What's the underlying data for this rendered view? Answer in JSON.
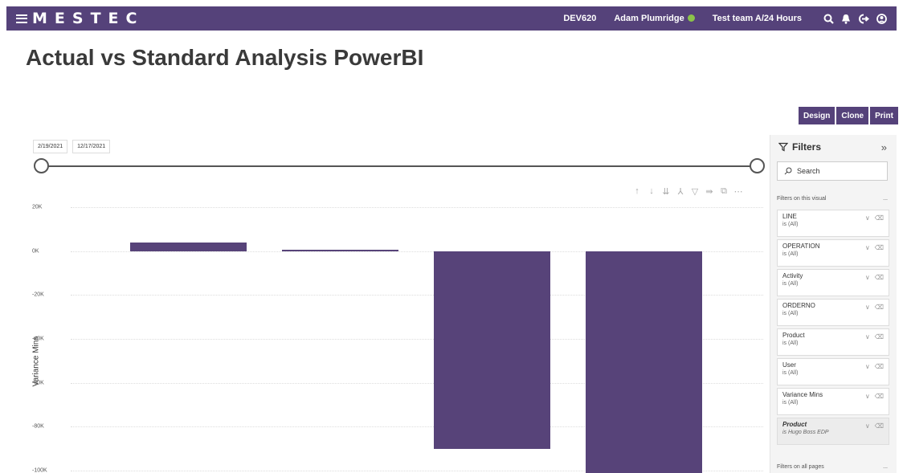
{
  "topbar": {
    "logo": "MESTEC",
    "env": "DEV620",
    "user": "Adam Plumridge",
    "team": "Test team A/24 Hours",
    "icons": [
      "search-icon",
      "bell-icon",
      "logout-icon",
      "user-circle-icon"
    ]
  },
  "page": {
    "title": "Actual vs Standard Analysis PowerBI"
  },
  "actions": {
    "design": "Design",
    "clone": "Clone",
    "print": "Print"
  },
  "date_range": {
    "start": "2/19/2021",
    "end": "12/17/2021"
  },
  "visual_toolbar": {
    "icons": [
      "sort-up-icon",
      "sort-down-icon",
      "drill-down-icon",
      "expand-hierarchy-icon",
      "filter-icon",
      "pin-icon",
      "focus-mode-icon",
      "more-options-icon"
    ],
    "more": "⋯"
  },
  "chart_data": {
    "type": "bar",
    "categories": [
      "",
      "",
      "",
      ""
    ],
    "values": [
      4000,
      500,
      -90000,
      -110000
    ],
    "title": "",
    "xlabel": "",
    "ylabel": "Variance Mins",
    "ylim": [
      -100000,
      20000
    ],
    "y_ticks": [
      "20K",
      "0K",
      "-20K",
      "-40K",
      "-60K",
      "-80K",
      "-100K"
    ],
    "grid": true,
    "bar_color": "#574379"
  },
  "filters": {
    "title": "Filters",
    "search_placeholder": "Search",
    "section_visual": "Filters on this visual",
    "section_pages": "Filters on all pages",
    "section_more": "...",
    "items": [
      {
        "name": "LINE",
        "value": "is (All)"
      },
      {
        "name": "OPERATION",
        "value": "is (All)"
      },
      {
        "name": "Activity",
        "value": "is (All)"
      },
      {
        "name": "ORDERNO",
        "value": "is (All)"
      },
      {
        "name": "Product",
        "value": "is (All)"
      },
      {
        "name": "User",
        "value": "is (All)"
      },
      {
        "name": "Variance Mins",
        "value": "is (All)"
      },
      {
        "name": "Product",
        "value": "is Hugo Boss EDP"
      }
    ]
  },
  "colors": {
    "accent": "#55427a",
    "bar": "#574379"
  }
}
